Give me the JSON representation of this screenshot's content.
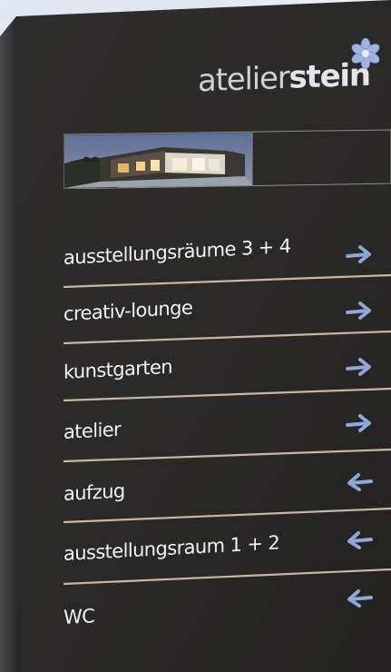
{
  "sign": {
    "logo": {
      "light": "atelier",
      "bold": "stein",
      "flower": "flower-logo-icon"
    },
    "rows": [
      {
        "label": "ausstellungsräume 3 + 4",
        "direction": "right"
      },
      {
        "label": "creativ-lounge",
        "direction": "right"
      },
      {
        "label": "kunstgarten",
        "direction": "right"
      },
      {
        "label": "atelier",
        "direction": "right"
      },
      {
        "label": "aufzug",
        "direction": "left"
      },
      {
        "label": "ausstellungsraum 1 + 2",
        "direction": "left"
      },
      {
        "label": "WC",
        "direction": "left"
      }
    ],
    "colors": {
      "panel": "#2b2a29",
      "divider": "#c9b7a0",
      "arrow": "#8fa6d8",
      "text": "#f2f2f4"
    }
  }
}
